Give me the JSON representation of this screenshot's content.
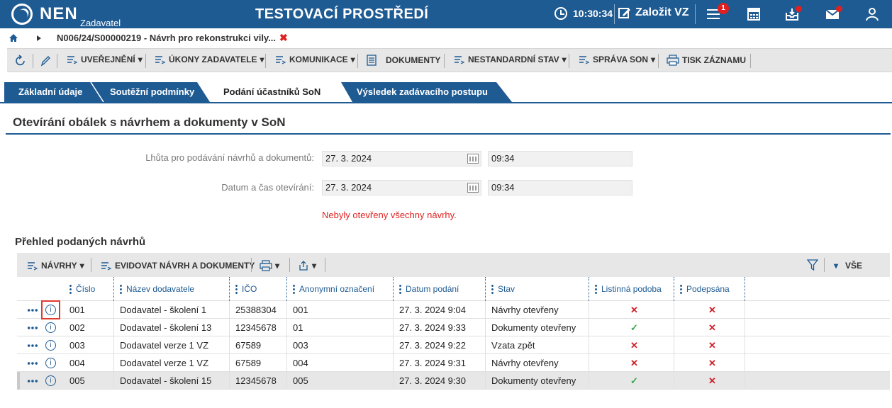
{
  "header": {
    "logo_text": "NEN",
    "logo_sub": "Zadavatel",
    "environment": "TESTOVACÍ PROSTŘEDÍ",
    "time": "10:30:34",
    "create_label": "Založit VZ",
    "notifications_count": "1",
    "accent_color": "#1f5b93"
  },
  "breadcrumb": {
    "label": "N006/24/S00000219 - Návrh pro rekonstrukci vily..."
  },
  "toolbar": {
    "items": [
      {
        "label": "UVEŘEJNĚNÍ"
      },
      {
        "label": "ÚKONY ZADAVATELE"
      },
      {
        "label": "KOMUNIKACE"
      },
      {
        "label": "DOKUMENTY"
      },
      {
        "label": "NESTANDARDNÍ STAV"
      },
      {
        "label": "SPRÁVA SON"
      },
      {
        "label": "TISK ZÁZNAMU"
      }
    ]
  },
  "tabs": [
    {
      "label": "Základní údaje"
    },
    {
      "label": "Soutěžní podmínky"
    },
    {
      "label": "Podání účastníků SoN"
    },
    {
      "label": "Výsledek zadávacího postupu"
    }
  ],
  "section": {
    "title": "Otevírání obálek s návrhem a dokumenty v SoN",
    "deadline_label": "Lhůta pro podávání návrhů a dokumentů:",
    "deadline_date": "27. 3. 2024",
    "deadline_time": "09:34",
    "opening_label": "Datum a čas otevírání:",
    "opening_date": "27. 3. 2024",
    "opening_time": "09:34",
    "warning": "Nebyly otevřeny všechny návrhy."
  },
  "grid": {
    "title": "Přehled podaných návrhů",
    "toolbar": {
      "navrhy": "NÁVRHY",
      "evidovat": "EVIDOVAT NÁVRH A DOKUMENTY",
      "all": "VŠE"
    },
    "columns": [
      "Číslo",
      "Název dodavatele",
      "IČO",
      "Anonymní označení",
      "Datum podání",
      "Stav",
      "Listinná podoba",
      "Podepsána"
    ],
    "rows": [
      {
        "cislo": "001",
        "nazev": "Dodavatel - školení 1",
        "ico": "25388304",
        "anon": "001",
        "datum": "27. 3. 2024 9:04",
        "stav": "Návrhy otevřeny",
        "listinna": "✕",
        "podepsana": "✕"
      },
      {
        "cislo": "002",
        "nazev": "Dodavatel - školení 13",
        "ico": "12345678",
        "anon": "01",
        "datum": "27. 3. 2024 9:33",
        "stav": "Dokumenty otevřeny",
        "listinna": "✓",
        "podepsana": "✕"
      },
      {
        "cislo": "003",
        "nazev": "Dodavatel verze 1 VZ",
        "ico": "67589",
        "anon": "003",
        "datum": "27. 3. 2024 9:22",
        "stav": "Vzata zpět",
        "listinna": "✕",
        "podepsana": "✕"
      },
      {
        "cislo": "004",
        "nazev": "Dodavatel verze 1 VZ",
        "ico": "67589",
        "anon": "004",
        "datum": "27. 3. 2024 9:31",
        "stav": "Návrhy otevřeny",
        "listinna": "✕",
        "podepsana": "✕"
      },
      {
        "cislo": "005",
        "nazev": "Dodavatel - školení 15",
        "ico": "12345678",
        "anon": "005",
        "datum": "27. 3. 2024 9:30",
        "stav": "Dokumenty otevřeny",
        "listinna": "✓",
        "podepsana": "✕"
      }
    ]
  }
}
